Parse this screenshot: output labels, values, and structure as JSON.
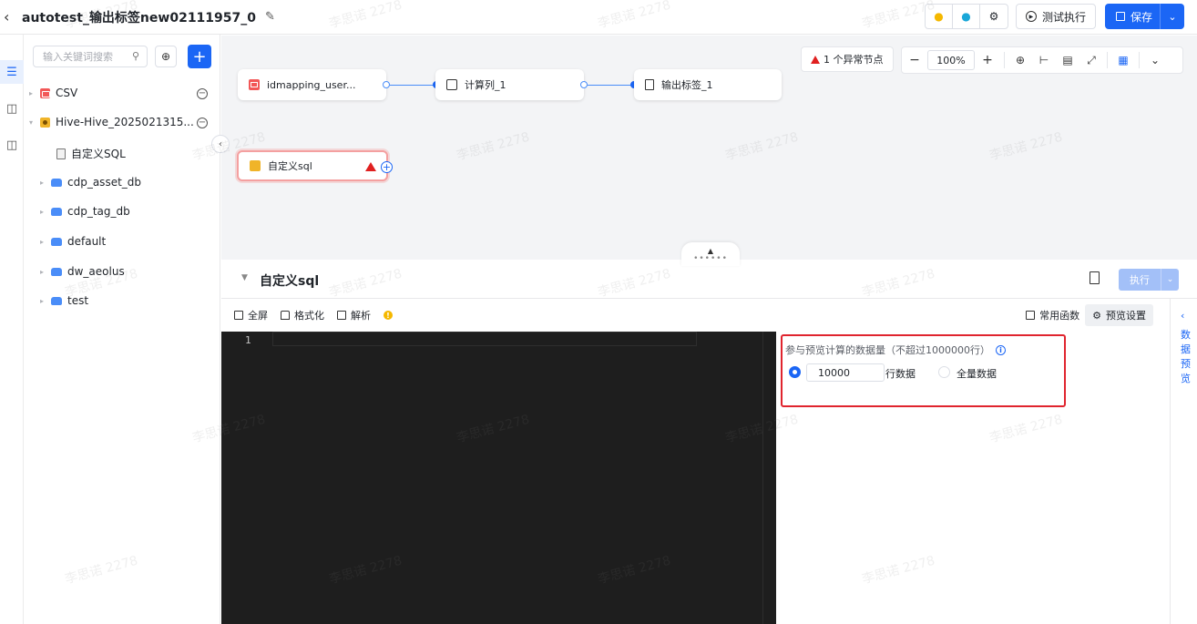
{
  "header": {
    "title": "autotest_输出标签new02111957_0",
    "test_run_label": "测试执行",
    "save_label": "保存"
  },
  "tree": {
    "search_placeholder": "输入关键词搜索",
    "nodes": [
      {
        "label": "CSV"
      },
      {
        "label": "Hive-Hive_2025021315..."
      },
      {
        "label": "自定义SQL"
      },
      {
        "label": "cdp_asset_db"
      },
      {
        "label": "cdp_tag_db"
      },
      {
        "label": "default"
      },
      {
        "label": "dw_aeolus"
      },
      {
        "label": "test"
      }
    ]
  },
  "canvas": {
    "nodes": [
      {
        "label": "idmapping_user..."
      },
      {
        "label": "计算列_1"
      },
      {
        "label": "输出标签_1"
      },
      {
        "label": "自定义sql"
      }
    ],
    "abnormal_label": "1 个异常节点",
    "zoom": "100%"
  },
  "panel": {
    "title": "自定义sql",
    "run_label": "执行",
    "toolbar": {
      "fullscreen": "全屏",
      "format": "格式化",
      "parse": "解析",
      "functions": "常用函数",
      "preview_settings": "预览设置"
    },
    "editor": {
      "line_number": "1"
    },
    "settings": {
      "label": "参与预览计算的数据量（不超过1000000行）",
      "rows_value": "10000",
      "rows_unit": "行数据",
      "all_data": "全量数据",
      "selected_option": "rows"
    },
    "side_tab": "数据预览"
  },
  "watermark": "李思诺 2278",
  "colors": {
    "accent": "#1b66f5",
    "error": "#e02020",
    "editor_bg": "#1e1e1e"
  }
}
